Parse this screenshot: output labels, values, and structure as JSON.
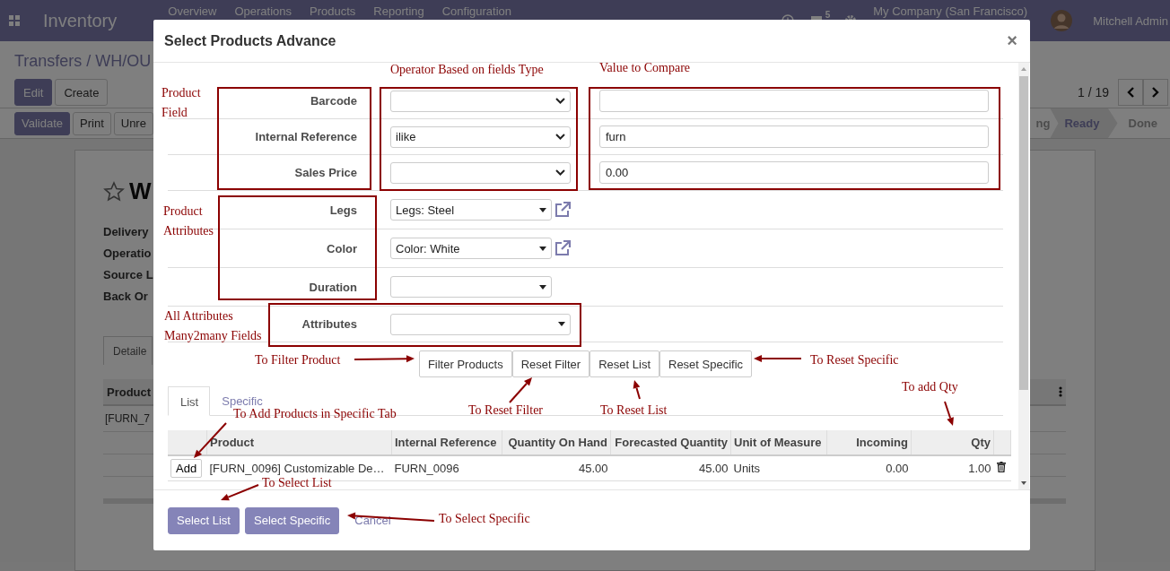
{
  "navbar": {
    "app_title": "Inventory",
    "menu": [
      "Overview",
      "Operations",
      "Products",
      "Reporting",
      "Configuration"
    ],
    "chat_badge": "5",
    "company": "My Company (San Francisco)",
    "user": "Mitchell Admin"
  },
  "breadcrumb": "Transfers / WH/OU",
  "actions": [
    "Edit",
    "Create"
  ],
  "pager": "1 / 19",
  "form_buttons": [
    "Validate",
    "Print",
    "Unre"
  ],
  "status_steps": [
    {
      "label": "ng",
      "selected": false
    },
    {
      "label": "Ready",
      "selected": true
    },
    {
      "label": "Done",
      "selected": false
    }
  ],
  "record": {
    "title": "W",
    "starred": false,
    "fields": [
      "Delivery",
      "Operatio",
      "Source L",
      "Back Or"
    ],
    "tab": "Detaile",
    "table_header": "Product",
    "row": "[FURN_7"
  },
  "dialog": {
    "title": "Select Products Advance",
    "close": "×",
    "field_rows": [
      {
        "label": "Barcode"
      },
      {
        "label": "Internal Reference",
        "operator": "ilike",
        "value": "furn"
      },
      {
        "label": "Sales Price",
        "value": "0.00"
      }
    ],
    "attribute_rows": [
      {
        "label": "Legs",
        "value": "Legs: Steel",
        "link": true
      },
      {
        "label": "Color",
        "value": "Color: White",
        "link": true
      },
      {
        "label": "Duration",
        "link": false
      }
    ],
    "many2many": {
      "label": "Attributes"
    },
    "buttons": [
      "Filter Products",
      "Reset Filter",
      "Reset List",
      "Reset Specific"
    ],
    "tabs": [
      {
        "label": "List",
        "selected": true
      },
      {
        "label": "Specific",
        "selected": false
      }
    ],
    "table": {
      "columns": [
        "Product",
        "Internal Reference",
        "Quantity On Hand",
        "Forecasted Quantity",
        "Unit of Measure",
        "Incoming",
        "Qty"
      ],
      "rows": [
        {
          "action": "Add",
          "cells": [
            "[FURN_0096] Customizable De…",
            "FURN_0096",
            "45.00",
            "45.00",
            "Units",
            "0.00",
            "1.00"
          ]
        }
      ]
    },
    "footer": [
      "Select List",
      "Select Specific"
    ],
    "cancel": "Cancel"
  },
  "annotations": [
    "Operator Based on fields Type",
    "Value to Compare",
    "Product Field",
    "Product Attributes",
    "All Attributes Many2many Fields",
    "To Filter Product",
    "To Reset Specific",
    "To Add Products in Specific Tab",
    "To Reset Filter",
    "To Reset List",
    "To add Qty",
    "To Select List",
    "To Select Specific"
  ]
}
